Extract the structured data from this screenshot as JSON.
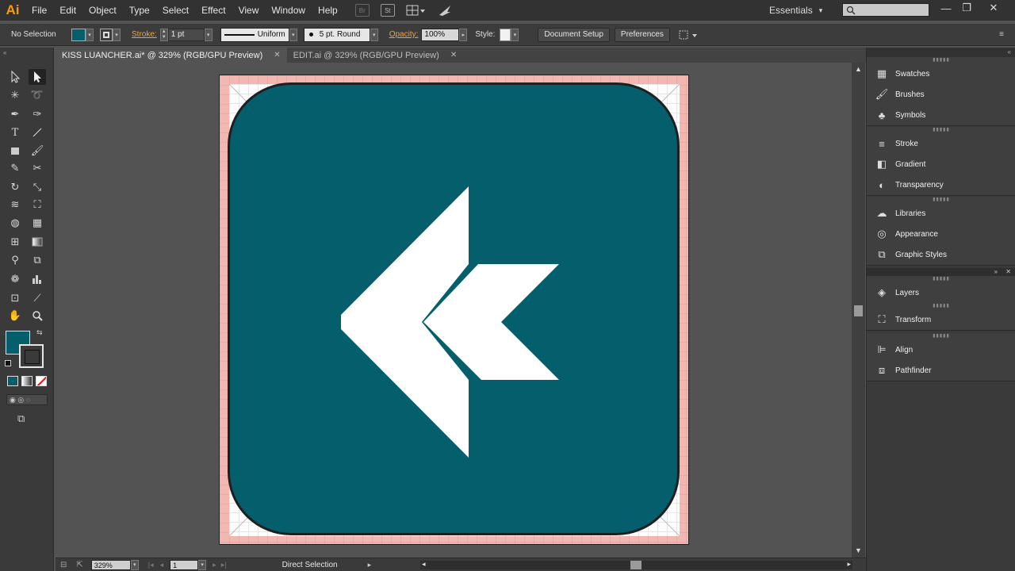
{
  "app": {
    "logo": "Ai"
  },
  "menu": [
    "File",
    "Edit",
    "Object",
    "Type",
    "Select",
    "Effect",
    "View",
    "Window",
    "Help"
  ],
  "menu_icons": {
    "bridge": "Br",
    "stock": "St"
  },
  "workspace": {
    "label": "Essentials",
    "arrow": "▾"
  },
  "window_controls": {
    "minimize": "—",
    "restore": "❐",
    "close": "✕"
  },
  "control": {
    "selection": "No Selection",
    "stroke_label": "Stroke:",
    "stroke_weight": "1 pt",
    "profile": "Uniform",
    "brush": "5 pt. Round",
    "opacity_label": "Opacity:",
    "opacity": "100%",
    "style_label": "Style:",
    "document_setup": "Document Setup",
    "preferences": "Preferences"
  },
  "tabs": [
    {
      "label": "KISS LUANCHER.ai* @ 329% (RGB/GPU Preview)",
      "close": "✕"
    },
    {
      "label": "EDIT.ai @ 329% (RGB/GPU Preview)",
      "close": "✕"
    }
  ],
  "status": {
    "zoom": "329%",
    "artboard": "1",
    "tool": "Direct Selection"
  },
  "panels": {
    "group1": [
      "Swatches",
      "Brushes",
      "Symbols"
    ],
    "group2": [
      "Stroke",
      "Gradient",
      "Transparency"
    ],
    "group3": [
      "Libraries",
      "Appearance",
      "Graphic Styles"
    ],
    "group4": [
      "Layers"
    ],
    "group5": [
      "Transform"
    ],
    "group6": [
      "Align",
      "Pathfinder"
    ]
  },
  "colors": {
    "fill": "#045e6c",
    "artboard_bleed": "#f3b7b2",
    "icon_glyph": "#ffffff"
  },
  "icons": {
    "tools": [
      "selection-tool-icon",
      "direct-selection-tool-icon",
      "magic-wand-icon",
      "lasso-icon",
      "pen-icon",
      "curvature-icon",
      "type-icon",
      "line-icon",
      "rectangle-icon",
      "paintbrush-icon",
      "pencil-icon",
      "scissors-icon",
      "rotate-icon",
      "scale-icon",
      "width-icon",
      "free-transform-icon",
      "shape-builder-icon",
      "graph-icon",
      "mesh-icon",
      "gradient-icon",
      "eyedropper-icon",
      "blend-icon",
      "symbol-sprayer-icon",
      "column-graph-icon",
      "artboard-icon",
      "slice-icon",
      "hand-icon",
      "zoom-icon"
    ]
  }
}
